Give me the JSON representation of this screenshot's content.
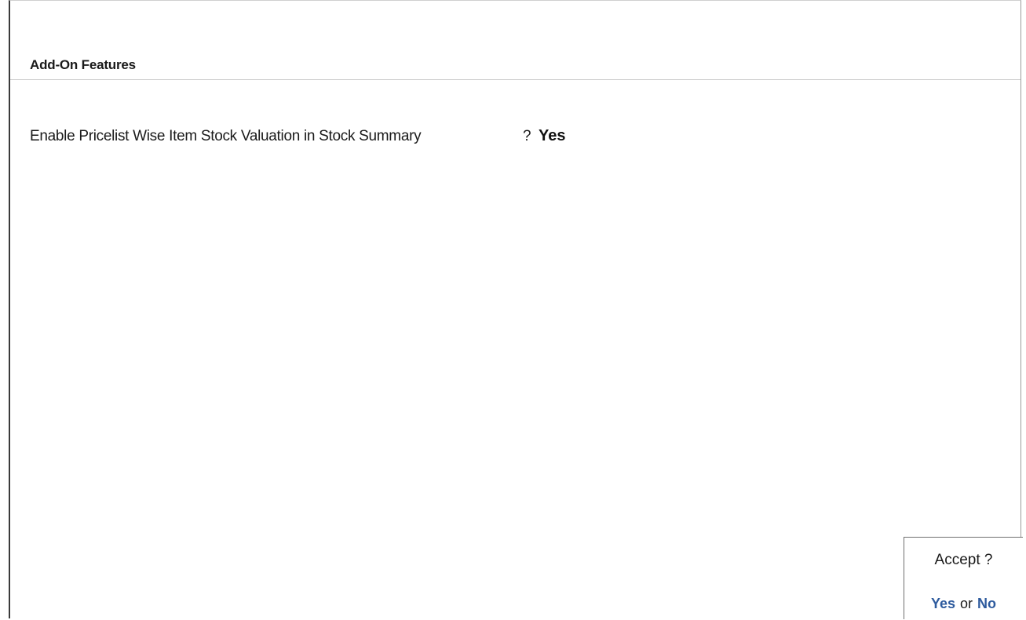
{
  "header": {
    "title": "Add-On Features"
  },
  "features": [
    {
      "label": "Enable Pricelist Wise Item Stock Valuation in Stock Summary",
      "prompt": "?",
      "value": "Yes"
    }
  ],
  "accept_dialog": {
    "question": "Accept ?",
    "yes_label": "Yes",
    "separator": "or",
    "no_label": "No"
  },
  "colors": {
    "option_accent": "#2e5b9e"
  }
}
